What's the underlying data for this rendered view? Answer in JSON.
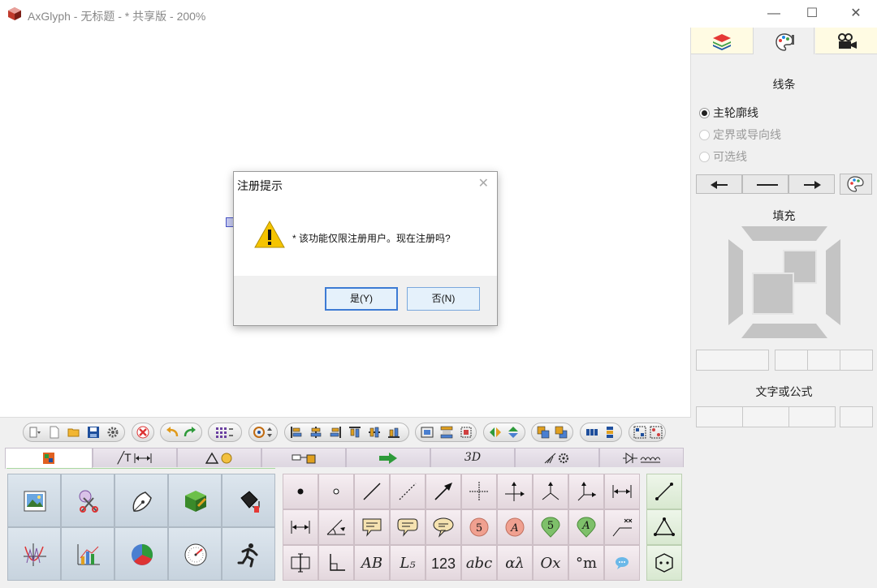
{
  "window": {
    "title": "AxGlyph - 无标题 - * 共享版 - 200%",
    "minimize": "—",
    "maximize": "☐",
    "close": "✕"
  },
  "right_panel": {
    "tabs": [
      "layers",
      "style",
      "animation"
    ],
    "lines_title": "线条",
    "line_options": [
      {
        "label": "主轮廓线",
        "selected": true,
        "enabled": true
      },
      {
        "label": "定界或导向线",
        "selected": false,
        "enabled": false
      },
      {
        "label": "可选线",
        "selected": false,
        "enabled": false
      }
    ],
    "fill_title": "填充",
    "text_title": "文字或公式"
  },
  "category_tabs": [
    "图像",
    "线/文字/尺寸",
    "形状",
    "流程",
    "箭头",
    "3D",
    "电路",
    "元件"
  ],
  "category_tab_labels": {
    "t1": "╱T",
    "t4": "",
    "t5": "3D"
  },
  "small_tools": {
    "row2": [
      "5",
      "A",
      "5",
      "A"
    ],
    "row3": [
      "AB",
      "L₅",
      "123",
      "abc",
      "αλ",
      "Ox",
      "°m"
    ]
  },
  "dialog": {
    "title": "注册提示",
    "message": "* 该功能仅限注册用户。现在注册吗?",
    "yes": "是(Y)",
    "no": "否(N)",
    "close": "✕"
  },
  "colors": {
    "accent": "#3d7bd4",
    "tab_bg": "#fffbe3",
    "warning": "#f5c400"
  }
}
